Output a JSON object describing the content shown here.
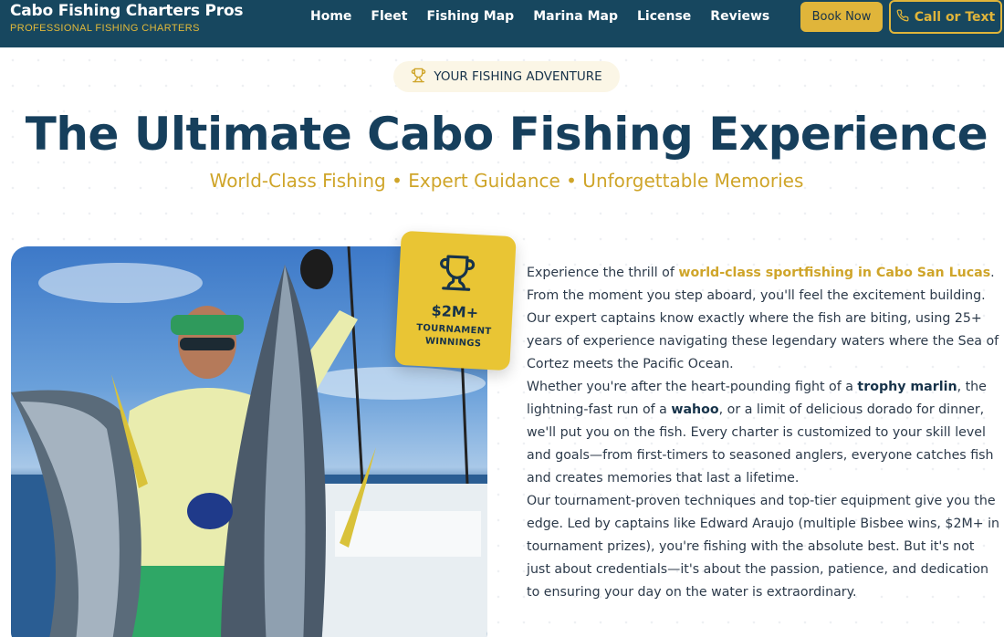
{
  "brand": {
    "title": "Cabo Fishing Charters Pros",
    "subtitle": "PROFESSIONAL FISHING CHARTERS"
  },
  "nav": {
    "items": [
      "Home",
      "Fleet",
      "Fishing Map",
      "Marina Map",
      "License",
      "Reviews"
    ]
  },
  "header_actions": {
    "book_label": "Book Now",
    "call_label": "Call or Text",
    "call_icon": "phone-icon"
  },
  "hero": {
    "pill_label": "YOUR FISHING ADVENTURE",
    "pill_icon": "trophy-icon",
    "title": "The Ultimate Cabo Fishing Experience",
    "subtitle": "World-Class Fishing • Expert Guidance • Unforgettable Memories"
  },
  "badge": {
    "icon": "trophy-icon",
    "amount": "$2M+",
    "label_line1": "TOURNAMENT",
    "label_line2": "WINNINGS"
  },
  "content": {
    "p1_pre": "Experience the thrill of ",
    "p1_highlight": "world-class sportfishing in Cabo San Lucas",
    "p1_post": ". From the moment you step aboard, you'll feel the excitement building. Our expert captains know exactly where the fish are biting, using 25+ years of experience navigating these legendary waters where the Sea of Cortez meets the Pacific Ocean.",
    "p2_pre": "Whether you're after the heart-pounding fight of a ",
    "p2_bold1": "trophy marlin",
    "p2_mid": ", the lightning-fast run of a ",
    "p2_bold2": "wahoo",
    "p2_post": ", or a limit of delicious dorado for dinner, we'll put you on the fish. Every charter is customized to your skill level and goals—from first-timers to seasoned anglers, everyone catches fish and creates memories that last a lifetime.",
    "p3": "Our tournament-proven techniques and top-tier equipment give you the edge. Led by captains like Edward Araujo (multiple Bisbee wins, $2M+ in tournament prizes), you're fishing with the absolute best. But it's not just about credentials—it's about the passion, patience, and dedication to ensuring your day on the water is extraordinary."
  },
  "colors": {
    "header_bg": "#17475f",
    "accent_gold": "#e0b53a",
    "title_navy": "#163f5c"
  }
}
